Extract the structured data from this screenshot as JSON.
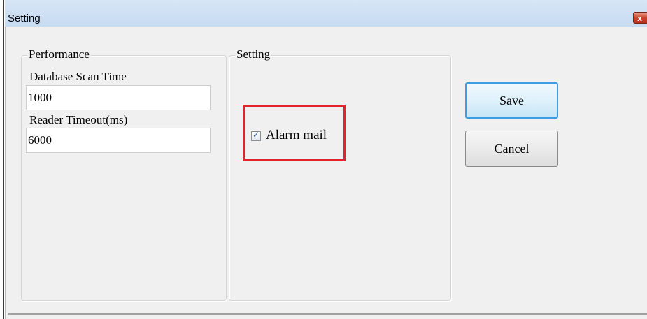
{
  "window": {
    "title": "Setting",
    "close_glyph": "x"
  },
  "performance": {
    "group_title": "Performance",
    "scan_time_label": "Database Scan Time",
    "scan_time_value": "1000",
    "timeout_label": "Reader Timeout(ms)",
    "timeout_value": "6000"
  },
  "setting": {
    "group_title": "Setting",
    "alarm_mail_label": "Alarm mail",
    "alarm_mail_checked": true
  },
  "buttons": {
    "save_label": "Save",
    "cancel_label": "Cancel"
  },
  "colors": {
    "highlight": "#e3242b",
    "save_border": "#3c9ee0"
  }
}
